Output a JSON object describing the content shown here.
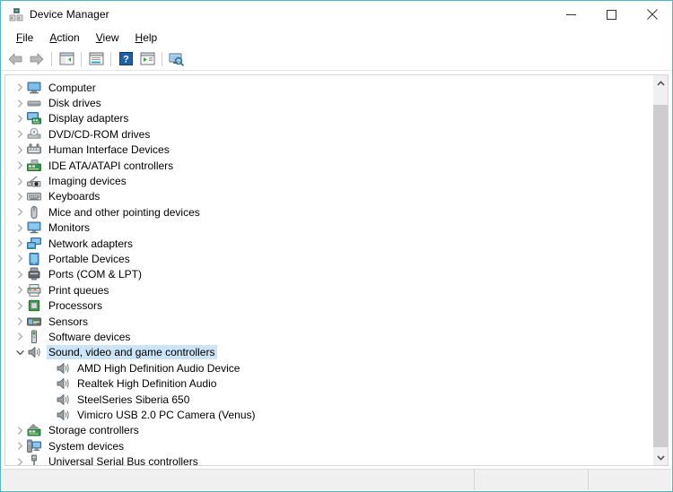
{
  "window": {
    "title": "Device Manager",
    "title_icon": "device-manager-icon",
    "border_color": "#4bb9c9",
    "minimize_label": "Minimize",
    "maximize_label": "Maximize",
    "close_label": "Close"
  },
  "menubar": {
    "items": [
      {
        "label": "File",
        "accel": "F"
      },
      {
        "label": "Action",
        "accel": "A"
      },
      {
        "label": "View",
        "accel": "V"
      },
      {
        "label": "Help",
        "accel": "H"
      }
    ]
  },
  "toolbar": {
    "buttons": [
      {
        "name": "back-icon",
        "tooltip": "Back"
      },
      {
        "name": "forward-icon",
        "tooltip": "Forward"
      },
      {
        "name": "show-hide-tree-icon",
        "tooltip": "Show/Hide Console Tree"
      },
      {
        "name": "properties-icon",
        "tooltip": "Properties"
      },
      {
        "name": "help-icon",
        "tooltip": "Help"
      },
      {
        "name": "update-driver-icon",
        "tooltip": "Update Driver Software"
      },
      {
        "name": "scan-hardware-icon",
        "tooltip": "Scan for hardware changes"
      }
    ]
  },
  "tree": {
    "selection_color": "#cce4f7",
    "items": [
      {
        "label": "Computer",
        "icon": "computer-icon",
        "level": 0,
        "expanded": false,
        "selected": false
      },
      {
        "label": "Disk drives",
        "icon": "disk-drive-icon",
        "level": 0,
        "expanded": false,
        "selected": false
      },
      {
        "label": "Display adapters",
        "icon": "display-adapter-icon",
        "level": 0,
        "expanded": false,
        "selected": false
      },
      {
        "label": "DVD/CD-ROM drives",
        "icon": "dvd-drive-icon",
        "level": 0,
        "expanded": false,
        "selected": false
      },
      {
        "label": "Human Interface Devices",
        "icon": "hid-icon",
        "level": 0,
        "expanded": false,
        "selected": false
      },
      {
        "label": "IDE ATA/ATAPI controllers",
        "icon": "ide-controller-icon",
        "level": 0,
        "expanded": false,
        "selected": false
      },
      {
        "label": "Imaging devices",
        "icon": "imaging-device-icon",
        "level": 0,
        "expanded": false,
        "selected": false
      },
      {
        "label": "Keyboards",
        "icon": "keyboard-icon",
        "level": 0,
        "expanded": false,
        "selected": false
      },
      {
        "label": "Mice and other pointing devices",
        "icon": "mouse-icon",
        "level": 0,
        "expanded": false,
        "selected": false
      },
      {
        "label": "Monitors",
        "icon": "monitor-icon",
        "level": 0,
        "expanded": false,
        "selected": false
      },
      {
        "label": "Network adapters",
        "icon": "network-adapter-icon",
        "level": 0,
        "expanded": false,
        "selected": false
      },
      {
        "label": "Portable Devices",
        "icon": "portable-device-icon",
        "level": 0,
        "expanded": false,
        "selected": false
      },
      {
        "label": "Ports (COM & LPT)",
        "icon": "port-icon",
        "level": 0,
        "expanded": false,
        "selected": false
      },
      {
        "label": "Print queues",
        "icon": "printer-icon",
        "level": 0,
        "expanded": false,
        "selected": false
      },
      {
        "label": "Processors",
        "icon": "processor-icon",
        "level": 0,
        "expanded": false,
        "selected": false
      },
      {
        "label": "Sensors",
        "icon": "sensor-icon",
        "level": 0,
        "expanded": false,
        "selected": false
      },
      {
        "label": "Software devices",
        "icon": "software-device-icon",
        "level": 0,
        "expanded": false,
        "selected": false
      },
      {
        "label": "Sound, video and game controllers",
        "icon": "sound-controller-icon",
        "level": 0,
        "expanded": true,
        "selected": true
      },
      {
        "label": "AMD High Definition Audio Device",
        "icon": "speaker-icon",
        "level": 1,
        "expanded": null,
        "selected": false
      },
      {
        "label": "Realtek High Definition Audio",
        "icon": "speaker-icon",
        "level": 1,
        "expanded": null,
        "selected": false
      },
      {
        "label": "SteelSeries Siberia 650",
        "icon": "speaker-icon",
        "level": 1,
        "expanded": null,
        "selected": false
      },
      {
        "label": "Vimicro USB 2.0 PC Camera (Venus)",
        "icon": "speaker-icon",
        "level": 1,
        "expanded": null,
        "selected": false
      },
      {
        "label": "Storage controllers",
        "icon": "storage-controller-icon",
        "level": 0,
        "expanded": false,
        "selected": false
      },
      {
        "label": "System devices",
        "icon": "system-device-icon",
        "level": 0,
        "expanded": false,
        "selected": false
      },
      {
        "label": "Universal Serial Bus controllers",
        "icon": "usb-controller-icon",
        "level": 0,
        "expanded": false,
        "selected": false
      }
    ]
  },
  "scrollbar": {
    "up_arrow": "⌃",
    "down_arrow": "⌄"
  },
  "statusbar": {
    "main_text": "",
    "mid_text": "",
    "end_text": ""
  }
}
